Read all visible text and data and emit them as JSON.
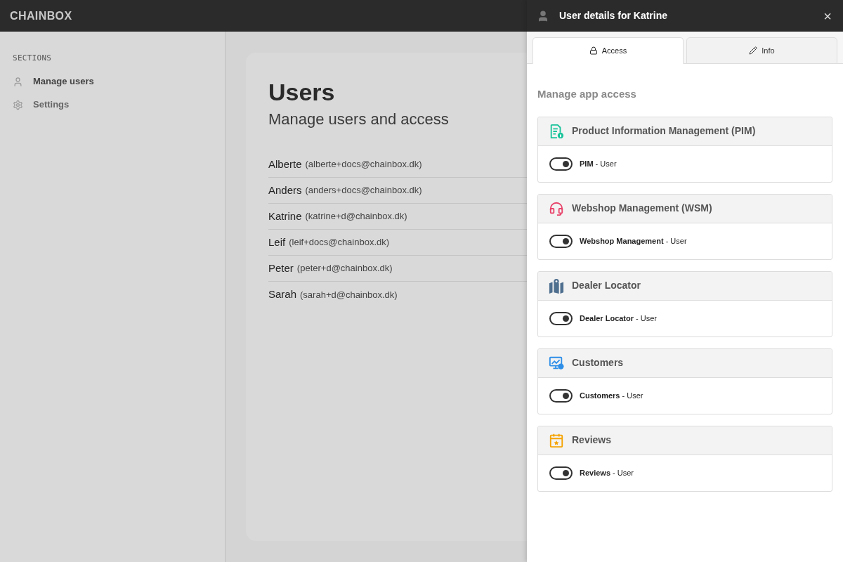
{
  "app": {
    "logo": "CHAINBOX"
  },
  "sidebar": {
    "heading": "SECTIONS",
    "items": [
      {
        "label": "Manage users",
        "selected": true
      },
      {
        "label": "Settings",
        "selected": false
      }
    ]
  },
  "main": {
    "title": "Users",
    "subtitle": "Manage users and access",
    "users": [
      {
        "name": "Alberte",
        "email": "(alberte+docs@chainbox.dk)"
      },
      {
        "name": "Anders",
        "email": "(anders+docs@chainbox.dk)"
      },
      {
        "name": "Katrine",
        "email": "(katrine+d@chainbox.dk)"
      },
      {
        "name": "Leif",
        "email": "(leif+docs@chainbox.dk)"
      },
      {
        "name": "Peter",
        "email": "(peter+d@chainbox.dk)"
      },
      {
        "name": "Sarah",
        "email": "(sarah+d@chainbox.dk)"
      }
    ]
  },
  "drawer": {
    "title": "User details for Katrine",
    "close": "×",
    "tabs": [
      {
        "label": "Access",
        "selected": true
      },
      {
        "label": "Info",
        "selected": false
      }
    ],
    "section_title": "Manage app access",
    "apps": [
      {
        "name": "Product Information Management (PIM)",
        "color": "#19c39a",
        "role_app": "PIM",
        "role": " - User",
        "on": true
      },
      {
        "name": "Webshop Management (WSM)",
        "color": "#e8436a",
        "role_app": "Webshop Management",
        "role": " - User",
        "on": true
      },
      {
        "name": "Dealer Locator",
        "color": "#4f6f8f",
        "role_app": "Dealer Locator",
        "role": " - User",
        "on": true
      },
      {
        "name": "Customers",
        "color": "#2f8fe8",
        "role_app": "Customers",
        "role": " - User",
        "on": true
      },
      {
        "name": "Reviews",
        "color": "#f5a300",
        "role_app": "Reviews",
        "role": " - User",
        "on": true
      }
    ]
  }
}
